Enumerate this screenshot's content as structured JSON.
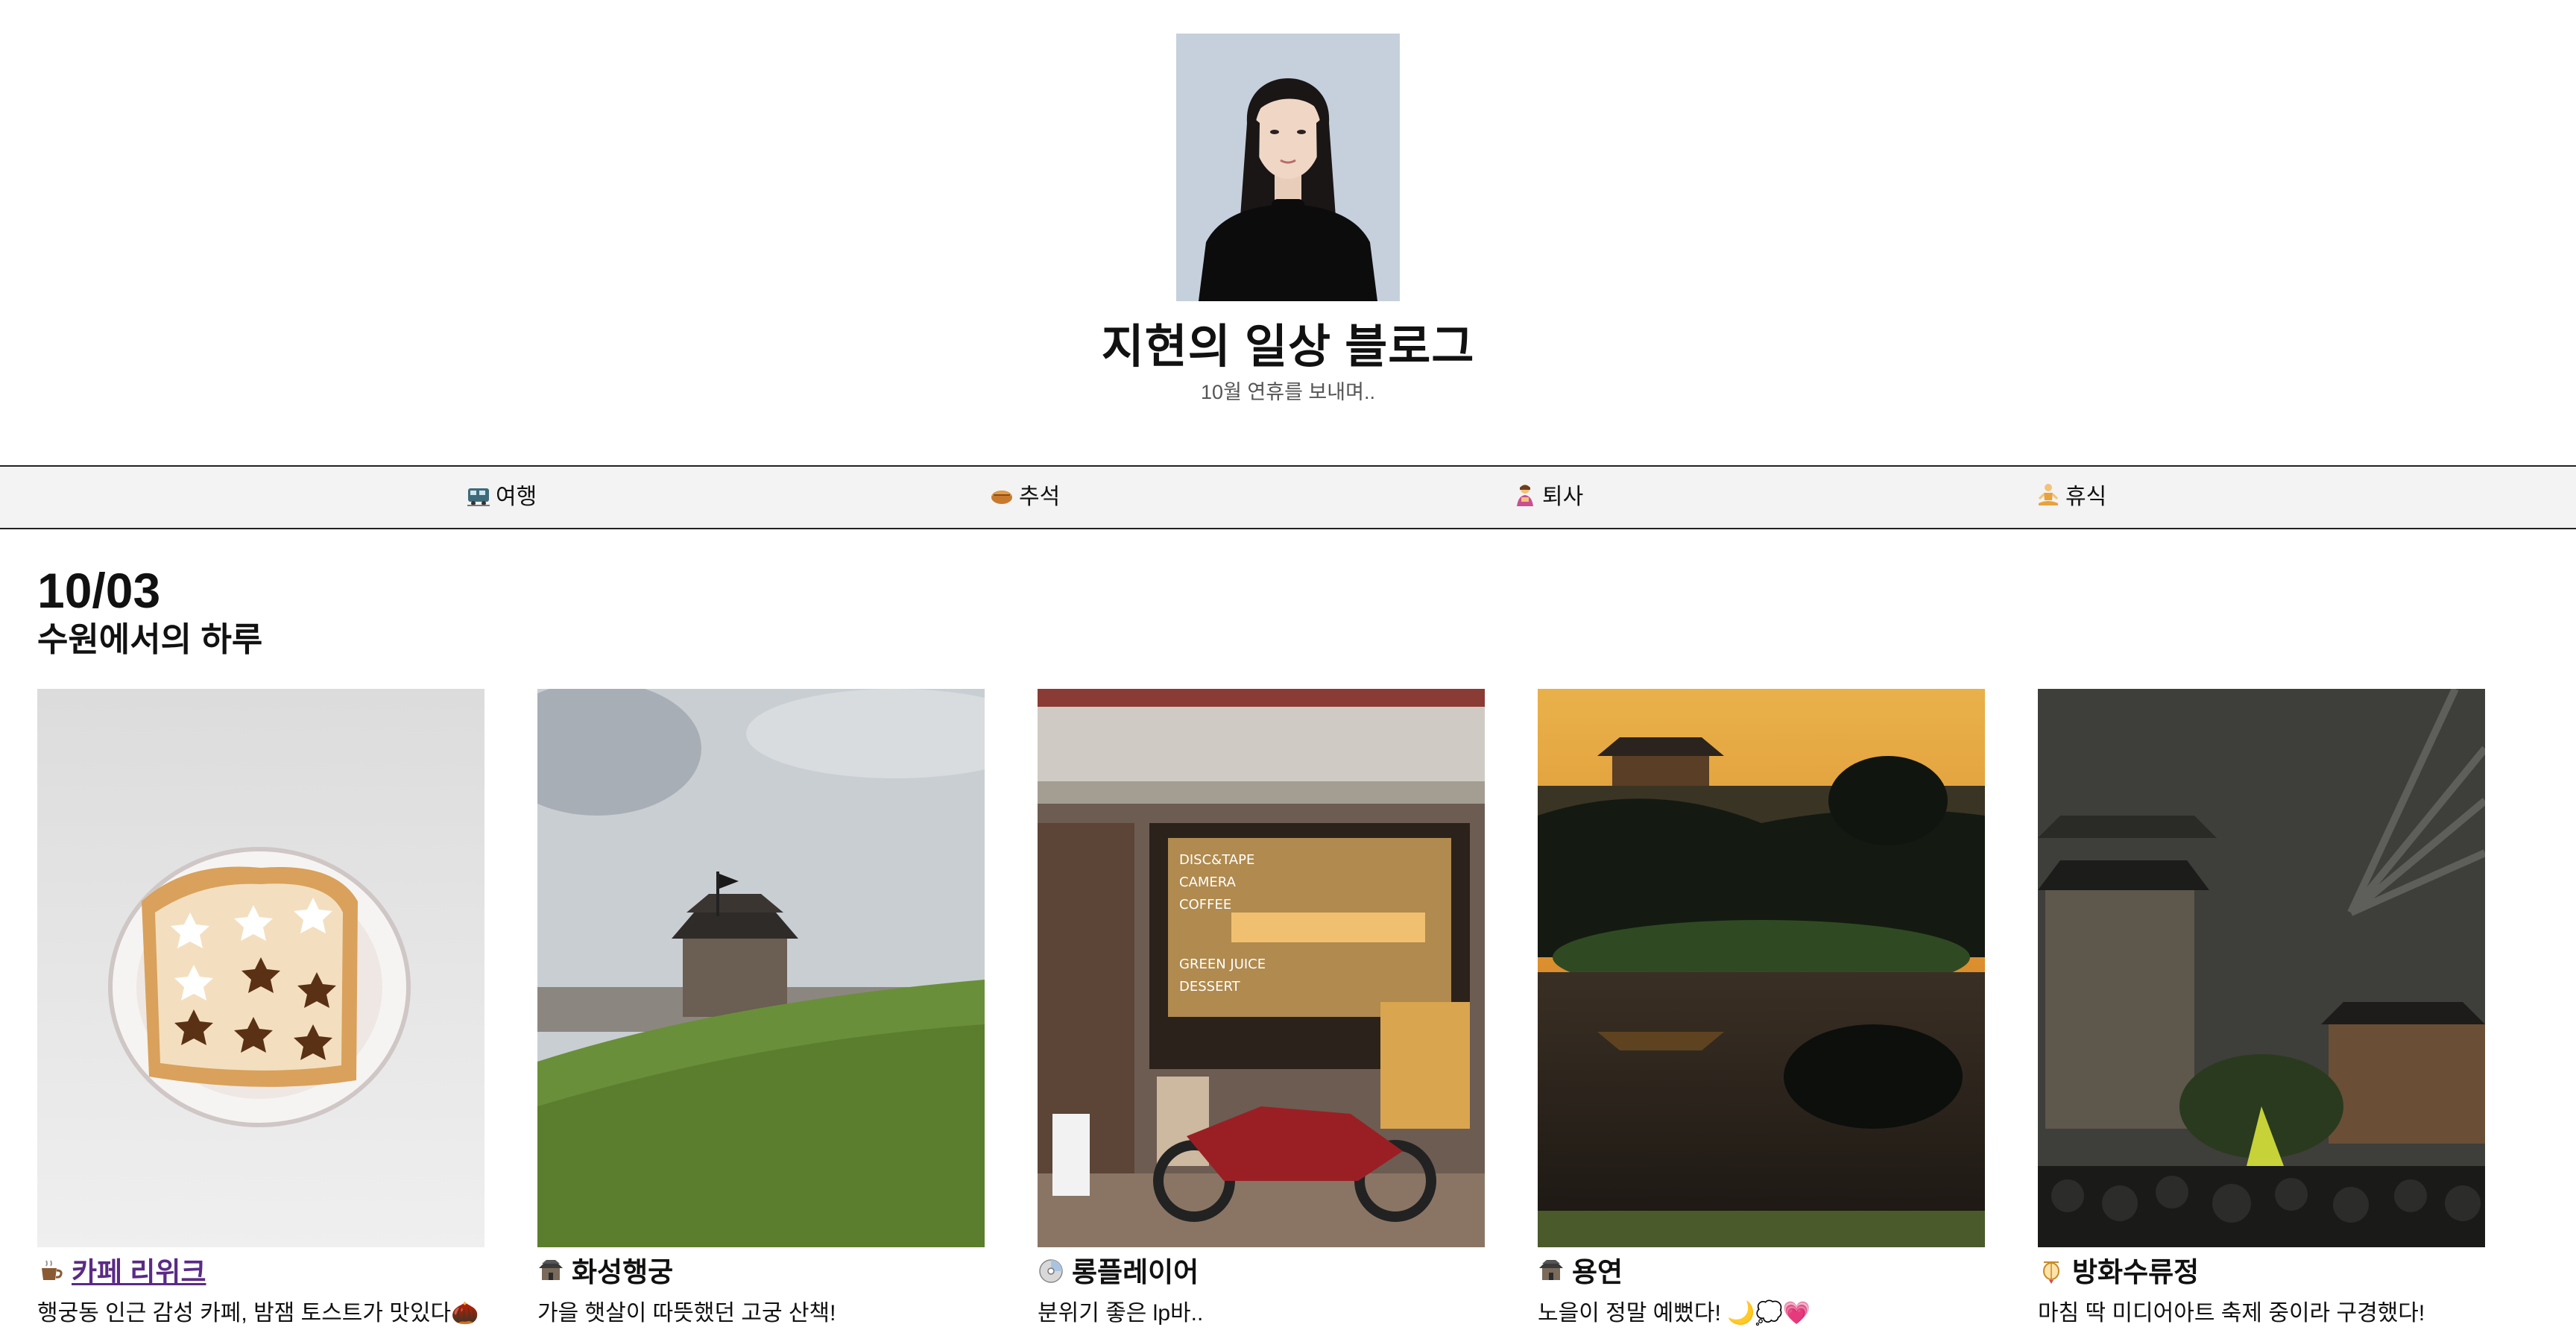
{
  "header": {
    "title": "지현의 일상 블로그",
    "subtitle": "10월 연휴를 보내며.."
  },
  "nav": [
    {
      "label": "여행",
      "icon": "train-icon"
    },
    {
      "label": "추석",
      "icon": "pie-icon"
    },
    {
      "label": "퇴사",
      "icon": "person-bowing-icon"
    },
    {
      "label": "휴식",
      "icon": "person-meditating-icon"
    }
  ],
  "post": {
    "date": "10/03",
    "title": "수원에서의 하루"
  },
  "cards": [
    {
      "title": "카페 리위크",
      "desc": "행궁동 인근 감성 카페, 밤잼 토스트가 맛있다🌰",
      "icon": "coffee-icon",
      "link": true
    },
    {
      "title": "화성행궁",
      "desc": "가을 햇살이 따뜻했던 고궁 산책!",
      "icon": "palace-icon",
      "link": false
    },
    {
      "title": "롱플레이어",
      "desc": "분위기 좋은 lp바..",
      "icon": "disc-icon",
      "link": false
    },
    {
      "title": "용연",
      "desc": "노을이 정말 예뻤다! 🌙💭💗",
      "icon": "palace-icon",
      "link": false
    },
    {
      "title": "방화수류정",
      "desc": "마침 딱 미디어아트 축제 중이라 구경했다!",
      "icon": "lantern-icon",
      "link": false
    }
  ],
  "colors": {
    "link_visited": "#5b2a86",
    "nav_bg": "#f3f3f3"
  }
}
